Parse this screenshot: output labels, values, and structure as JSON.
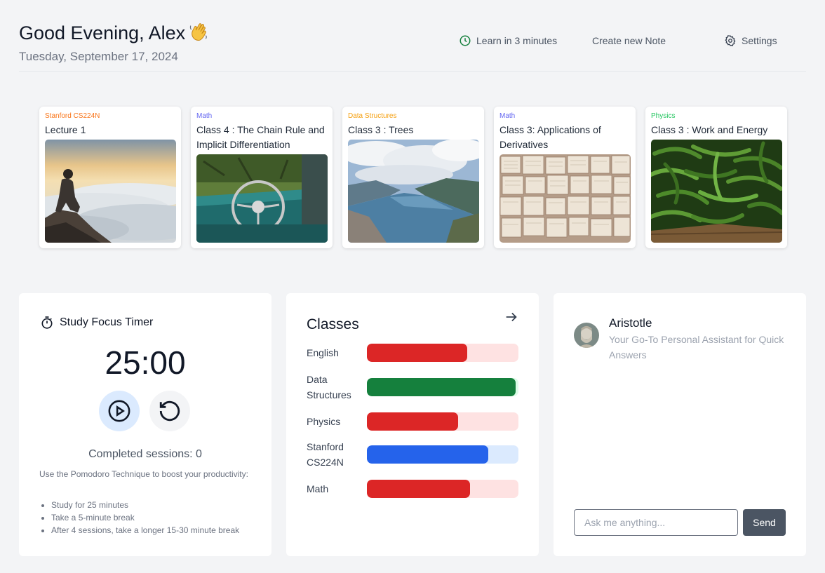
{
  "header": {
    "greeting": "Good Evening, Alex",
    "date": "Tuesday, September 17, 2024",
    "nav": {
      "learn": "Learn in 3 minutes",
      "note": "Create new Note",
      "settings": "Settings"
    }
  },
  "cards": [
    {
      "category": "Stanford CS224N",
      "title": "Lecture 1",
      "color": "#f97316",
      "image": "person-above-clouds"
    },
    {
      "category": "Math",
      "title": "Class 4 : The Chain Rule and Implicit Differentiation",
      "color": "#6366f1",
      "image": "vintage-car-steering-wheel"
    },
    {
      "category": "Data Structures",
      "title": "Class 3 : Trees",
      "color": "#f59e0b",
      "image": "fjord-landscape"
    },
    {
      "category": "Math",
      "title": "Class 3: Applications of Derivatives",
      "color": "#6366f1",
      "image": "open-books-wall"
    },
    {
      "category": "Physics",
      "title": "Class 3 : Work and Energy",
      "color": "#22c55e",
      "image": "green-beans"
    }
  ],
  "timer": {
    "title": "Study Focus Timer",
    "value": "25:00",
    "sessions": "Completed sessions: 0",
    "intro": "Use the Pomodoro Technique to boost your productivity:",
    "tips": [
      "Study for 25 minutes",
      "Take a 5-minute break",
      "After 4 sessions, take a longer 15-30 minute break"
    ]
  },
  "classes": {
    "title": "Classes",
    "items": [
      {
        "name": "English",
        "progress": 0.66,
        "fill": "#dc2626",
        "track": "#fee2e2"
      },
      {
        "name": "Data Structures",
        "progress": 0.98,
        "fill": "#15803d",
        "track": "#dcfce7"
      },
      {
        "name": "Physics",
        "progress": 0.6,
        "fill": "#dc2626",
        "track": "#fee2e2"
      },
      {
        "name": "Stanford CS224N",
        "progress": 0.8,
        "fill": "#2563eb",
        "track": "#dbeafe"
      },
      {
        "name": "Math",
        "progress": 0.68,
        "fill": "#dc2626",
        "track": "#fee2e2"
      }
    ]
  },
  "assistant": {
    "name": "Aristotle",
    "description": "Your Go-To Personal Assistant for Quick Answers",
    "input_placeholder": "Ask me anything...",
    "send_label": "Send"
  }
}
